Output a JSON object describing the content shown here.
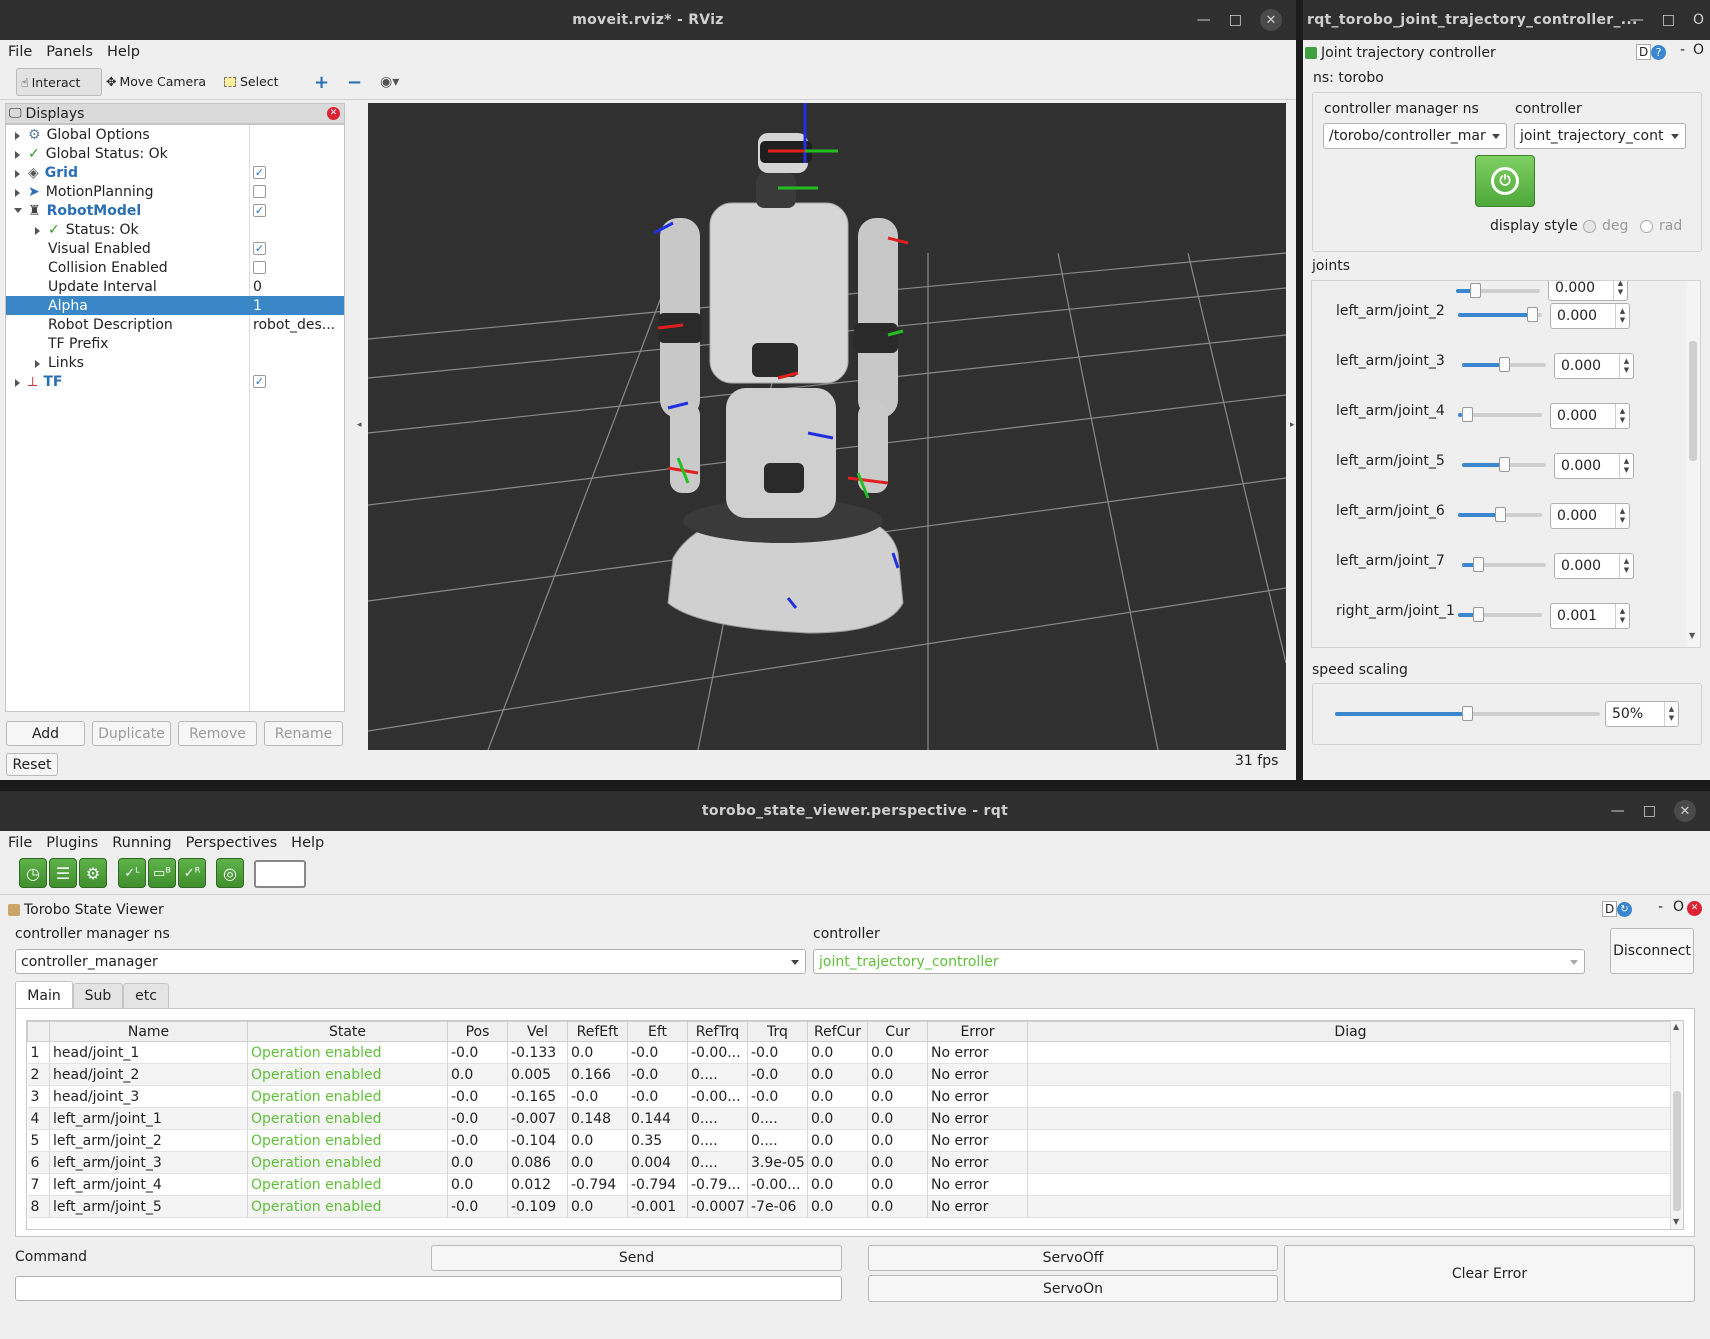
{
  "rviz": {
    "title": "moveit.rviz* - RViz",
    "menu": [
      "File",
      "Panels",
      "Help"
    ],
    "tools": {
      "interact": "Interact",
      "move_camera": "Move Camera",
      "select": "Select"
    },
    "displays_header": "Displays",
    "tree": {
      "global_options": "Global Options",
      "global_status": "Global Status: Ok",
      "grid": "Grid",
      "motion_planning": "MotionPlanning",
      "robot_model": "RobotModel",
      "status_ok": "Status: Ok",
      "visual_enabled": "Visual Enabled",
      "collision_enabled": "Collision Enabled",
      "update_interval": "Update Interval",
      "update_interval_value": "0",
      "alpha": "Alpha",
      "alpha_value": "1",
      "robot_description": "Robot Description",
      "robot_description_value": "robot_des...",
      "tf_prefix": "TF Prefix",
      "links": "Links",
      "tf": "TF"
    },
    "buttons": {
      "add": "Add",
      "duplicate": "Duplicate",
      "remove": "Remove",
      "rename": "Rename",
      "reset": "Reset"
    },
    "fps": "31 fps"
  },
  "jtc": {
    "title": "rqt_torobo_joint_trajectory_controller_...",
    "plugin_title": "Joint trajectory controller",
    "plugin_ctl": "D",
    "ns": "ns: torobo",
    "cm_ns_label": "controller manager ns",
    "cm_ns_value": "/torobo/controller_mar",
    "controller_label": "controller",
    "controller_value": "joint_trajectory_cont",
    "display_style_label": "display style",
    "deg": "deg",
    "rad": "rad",
    "joints_label": "joints",
    "joints": [
      {
        "name": "left_arm/joint_2",
        "value": "0.000",
        "level": 0.94
      },
      {
        "name": "left_arm/joint_3",
        "value": "0.000",
        "level": 0.5
      },
      {
        "name": "left_arm/joint_4",
        "value": "0.000",
        "level": 0.05
      },
      {
        "name": "left_arm/joint_5",
        "value": "0.000",
        "level": 0.5
      },
      {
        "name": "left_arm/joint_6",
        "value": "0.000",
        "level": 0.5
      },
      {
        "name": "left_arm/joint_7",
        "value": "0.000",
        "level": 0.15
      },
      {
        "name": "right_arm/joint_1",
        "value": "0.001",
        "level": 0.2
      }
    ],
    "top_partial_value": "0.000",
    "speed_label": "speed scaling",
    "speed_value": "50%",
    "speed_level": 0.5
  },
  "viewer": {
    "title": "torobo_state_viewer.perspective - rqt",
    "menu": [
      "File",
      "Plugins",
      "Running",
      "Perspectives",
      "Help"
    ],
    "plugin_title": "Torobo State Viewer",
    "cm_ns_label": "controller manager ns",
    "cm_ns_value": "controller_manager",
    "controller_label": "controller",
    "controller_value": "joint_trajectory_controller",
    "disconnect": "Disconnect",
    "tabs": [
      "Main",
      "Sub",
      "etc"
    ],
    "columns": [
      "Name",
      "State",
      "Pos",
      "Vel",
      "RefEft",
      "Eft",
      "RefTrq",
      "Trq",
      "RefCur",
      "Cur",
      "Error",
      "Diag"
    ],
    "rows": [
      [
        "1",
        "head/joint_1",
        "Operation enabled",
        "-0.0",
        "-0.133",
        "0.0",
        "-0.0",
        "-0.00...",
        "-0.0",
        "0.0",
        "0.0",
        "No error",
        ""
      ],
      [
        "2",
        "head/joint_2",
        "Operation enabled",
        "0.0",
        "0.005",
        "0.166",
        "-0.0",
        "0....",
        "-0.0",
        "0.0",
        "0.0",
        "No error",
        ""
      ],
      [
        "3",
        "head/joint_3",
        "Operation enabled",
        "-0.0",
        "-0.165",
        "-0.0",
        "-0.0",
        "-0.00...",
        "-0.0",
        "0.0",
        "0.0",
        "No error",
        ""
      ],
      [
        "4",
        "left_arm/joint_1",
        "Operation enabled",
        "-0.0",
        "-0.007",
        "0.148",
        "0.144",
        "0....",
        "0....",
        "0.0",
        "0.0",
        "No error",
        ""
      ],
      [
        "5",
        "left_arm/joint_2",
        "Operation enabled",
        "-0.0",
        "-0.104",
        "0.0",
        "0.35",
        "0....",
        "0....",
        "0.0",
        "0.0",
        "No error",
        ""
      ],
      [
        "6",
        "left_arm/joint_3",
        "Operation enabled",
        "0.0",
        "0.086",
        "0.0",
        "0.004",
        "0....",
        "3.9e-05",
        "0.0",
        "0.0",
        "No error",
        ""
      ],
      [
        "7",
        "left_arm/joint_4",
        "Operation enabled",
        "0.0",
        "0.012",
        "-0.794",
        "-0.794",
        "-0.79...",
        "-0.00...",
        "0.0",
        "0.0",
        "No error",
        ""
      ],
      [
        "8",
        "left_arm/joint_5",
        "Operation enabled",
        "-0.0",
        "-0.109",
        "0.0",
        "-0.001",
        "-0.0007",
        "-7e-06",
        "0.0",
        "0.0",
        "No error",
        ""
      ]
    ],
    "command_label": "Command",
    "send": "Send",
    "servo_off": "ServoOff",
    "servo_on": "ServoOn",
    "clear_error": "Clear Error"
  }
}
